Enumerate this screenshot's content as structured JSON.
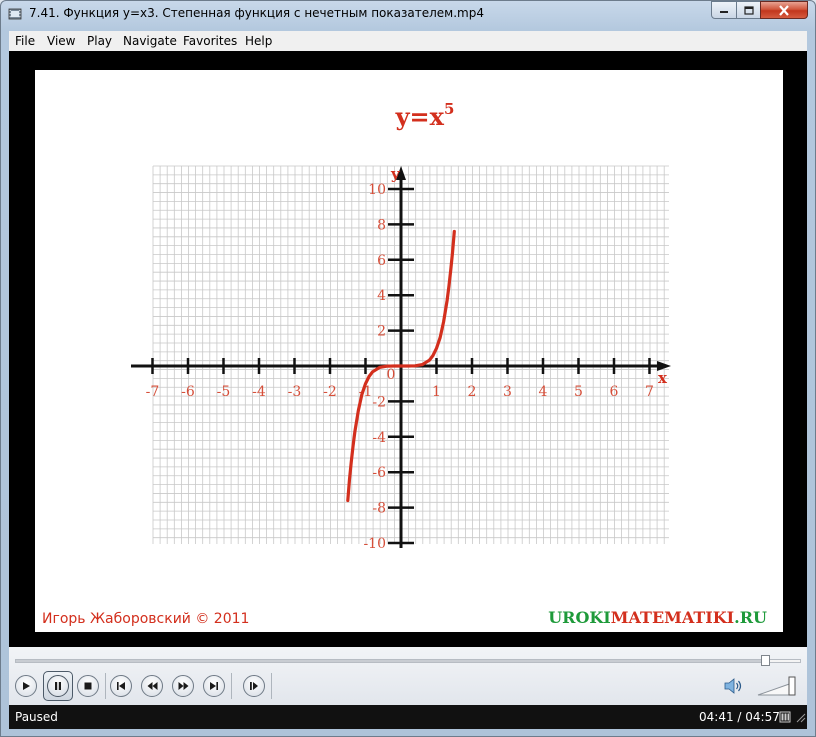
{
  "window": {
    "title": "7.41. Функция y=x3. Степенная функция с нечетным показателем.mp4"
  },
  "menu": {
    "items": [
      "File",
      "View",
      "Play",
      "Navigate",
      "Favorites",
      "Help"
    ]
  },
  "video": {
    "graph_title_base": "y=x",
    "graph_title_exp": "5",
    "y_axis_label": "y",
    "x_axis_label": "x",
    "author": "Игорь Жаборовский © 2011",
    "site_part1": "UROKI",
    "site_part2": "MATEMATIKI",
    "site_part3": ".RU",
    "colors": {
      "curve": "#d32f1d",
      "labels": "#d64f3a",
      "grid": "#c8c8c8",
      "axis": "#111111",
      "site_green": "#1e9a3a",
      "site_red": "#d32f1d"
    }
  },
  "chart_data": {
    "type": "line",
    "title": "y=x5",
    "xlabel": "x",
    "ylabel": "y",
    "xlim": [
      -7,
      7
    ],
    "ylim": [
      -10,
      10
    ],
    "x_ticks": [
      -7,
      -6,
      -5,
      -4,
      -3,
      -2,
      -1,
      1,
      2,
      3,
      4,
      5,
      6,
      7
    ],
    "y_ticks": [
      -10,
      -8,
      -6,
      -4,
      -2,
      2,
      4,
      6,
      8,
      10
    ],
    "origin_label": "0",
    "grid": true,
    "series": [
      {
        "x": [
          -1.5,
          -1.45,
          -1.4,
          -1.35,
          -1.3,
          -1.2,
          -1.1,
          -1.0,
          -0.9,
          -0.8,
          -0.6,
          -0.4,
          -0.2,
          0,
          0.2,
          0.4,
          0.6,
          0.8,
          0.9,
          1.0,
          1.1,
          1.2,
          1.3,
          1.35,
          1.4,
          1.45,
          1.5
        ],
        "y": [
          -7.6,
          -6.4,
          -5.4,
          -4.5,
          -3.7,
          -2.5,
          -1.6,
          -1.0,
          -0.59,
          -0.33,
          -0.08,
          -0.01,
          0,
          0,
          0,
          0.01,
          0.08,
          0.33,
          0.59,
          1.0,
          1.6,
          2.5,
          3.7,
          4.5,
          5.4,
          6.4,
          7.6
        ]
      }
    ]
  },
  "controls": {
    "progress_fraction": 0.955,
    "buttons": [
      "play-button",
      "pause-button",
      "stop-button",
      "skip-back-button",
      "rewind-button",
      "fast-forward-button",
      "skip-forward-button",
      "step-frame-button"
    ],
    "volume_level": 0.85
  },
  "status": {
    "state": "Paused",
    "time": "04:41 / 04:57"
  }
}
